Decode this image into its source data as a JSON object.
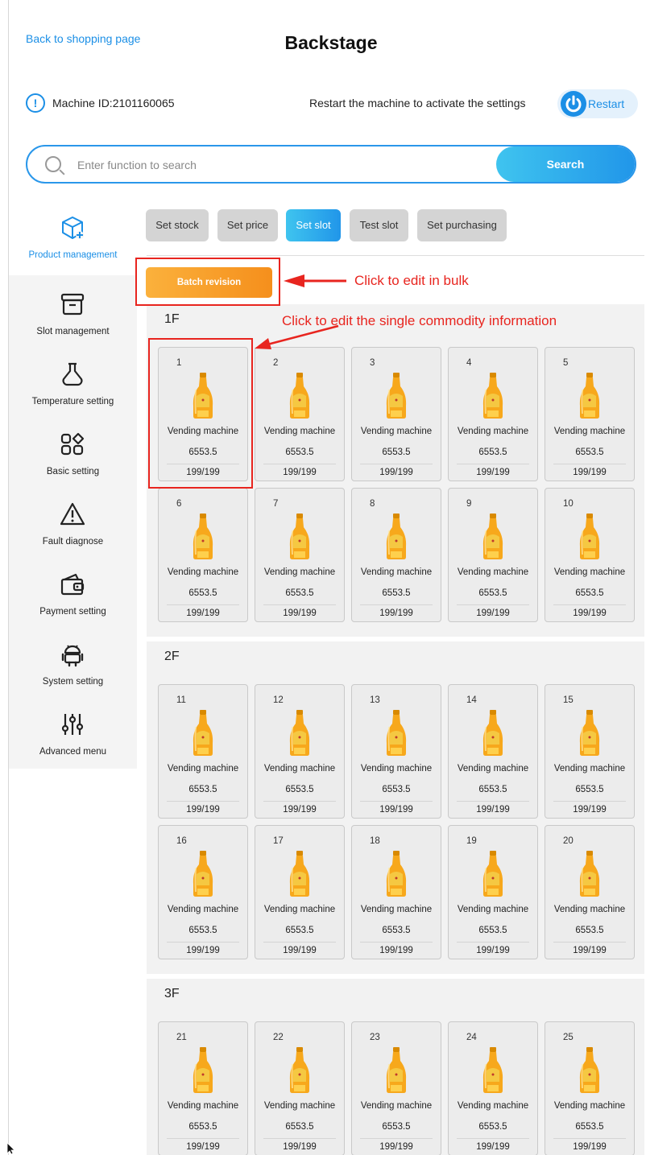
{
  "header": {
    "back_link": "Back to shopping page",
    "title": "Backstage"
  },
  "info": {
    "machine_id": "Machine ID:2101160065",
    "restart_hint": "Restart the machine to activate the settings",
    "restart_label": "Restart"
  },
  "search": {
    "placeholder": "Enter function to search",
    "button_label": "Search"
  },
  "sidebar": {
    "items": [
      {
        "label": "Product management",
        "icon": "box-plus-icon",
        "active": true
      },
      {
        "label": "Slot management",
        "icon": "tray-icon",
        "active": false
      },
      {
        "label": "Temperature setting",
        "icon": "flask-icon",
        "active": false
      },
      {
        "label": "Basic setting",
        "icon": "grid-diamond-icon",
        "active": false
      },
      {
        "label": "Fault diagnose",
        "icon": "warning-icon",
        "active": false
      },
      {
        "label": "Payment setting",
        "icon": "wallet-icon",
        "active": false
      },
      {
        "label": "System setting",
        "icon": "android-icon",
        "active": false
      },
      {
        "label": "Advanced menu",
        "icon": "sliders-icon",
        "active": false
      }
    ]
  },
  "tabs": [
    {
      "label": "Set stock",
      "active": false
    },
    {
      "label": "Set price",
      "active": false
    },
    {
      "label": "Set slot",
      "active": true
    },
    {
      "label": "Test slot",
      "active": false
    },
    {
      "label": "Set purchasing",
      "active": false
    }
  ],
  "batch_button": "Batch revision",
  "annotations": {
    "bulk": "Click to edit in bulk",
    "single": "Click to edit the single commodity information"
  },
  "floors": [
    {
      "label": "1F",
      "slots": [
        {
          "number": "1",
          "name": "Vending machine",
          "price": "6553.5",
          "stock": "199/199"
        },
        {
          "number": "2",
          "name": "Vending machine",
          "price": "6553.5",
          "stock": "199/199"
        },
        {
          "number": "3",
          "name": "Vending machine",
          "price": "6553.5",
          "stock": "199/199"
        },
        {
          "number": "4",
          "name": "Vending machine",
          "price": "6553.5",
          "stock": "199/199"
        },
        {
          "number": "5",
          "name": "Vending machine",
          "price": "6553.5",
          "stock": "199/199"
        },
        {
          "number": "6",
          "name": "Vending machine",
          "price": "6553.5",
          "stock": "199/199"
        },
        {
          "number": "7",
          "name": "Vending machine",
          "price": "6553.5",
          "stock": "199/199"
        },
        {
          "number": "8",
          "name": "Vending machine",
          "price": "6553.5",
          "stock": "199/199"
        },
        {
          "number": "9",
          "name": "Vending machine",
          "price": "6553.5",
          "stock": "199/199"
        },
        {
          "number": "10",
          "name": "Vending machine",
          "price": "6553.5",
          "stock": "199/199"
        }
      ]
    },
    {
      "label": "2F",
      "slots": [
        {
          "number": "11",
          "name": "Vending machine",
          "price": "6553.5",
          "stock": "199/199"
        },
        {
          "number": "12",
          "name": "Vending machine",
          "price": "6553.5",
          "stock": "199/199"
        },
        {
          "number": "13",
          "name": "Vending machine",
          "price": "6553.5",
          "stock": "199/199"
        },
        {
          "number": "14",
          "name": "Vending machine",
          "price": "6553.5",
          "stock": "199/199"
        },
        {
          "number": "15",
          "name": "Vending machine",
          "price": "6553.5",
          "stock": "199/199"
        },
        {
          "number": "16",
          "name": "Vending machine",
          "price": "6553.5",
          "stock": "199/199"
        },
        {
          "number": "17",
          "name": "Vending machine",
          "price": "6553.5",
          "stock": "199/199"
        },
        {
          "number": "18",
          "name": "Vending machine",
          "price": "6553.5",
          "stock": "199/199"
        },
        {
          "number": "19",
          "name": "Vending machine",
          "price": "6553.5",
          "stock": "199/199"
        },
        {
          "number": "20",
          "name": "Vending machine",
          "price": "6553.5",
          "stock": "199/199"
        }
      ]
    },
    {
      "label": "3F",
      "slots": [
        {
          "number": "21",
          "name": "Vending machine",
          "price": "6553.5",
          "stock": "199/199"
        },
        {
          "number": "22",
          "name": "Vending machine",
          "price": "6553.5",
          "stock": "199/199"
        },
        {
          "number": "23",
          "name": "Vending machine",
          "price": "6553.5",
          "stock": "199/199"
        },
        {
          "number": "24",
          "name": "Vending machine",
          "price": "6553.5",
          "stock": "199/199"
        },
        {
          "number": "25",
          "name": "Vending machine",
          "price": "6553.5",
          "stock": "199/199"
        }
      ]
    }
  ],
  "colors": {
    "accent": "#1b8fe6",
    "annotation": "#e8251f",
    "batch": "#f7a12b"
  }
}
